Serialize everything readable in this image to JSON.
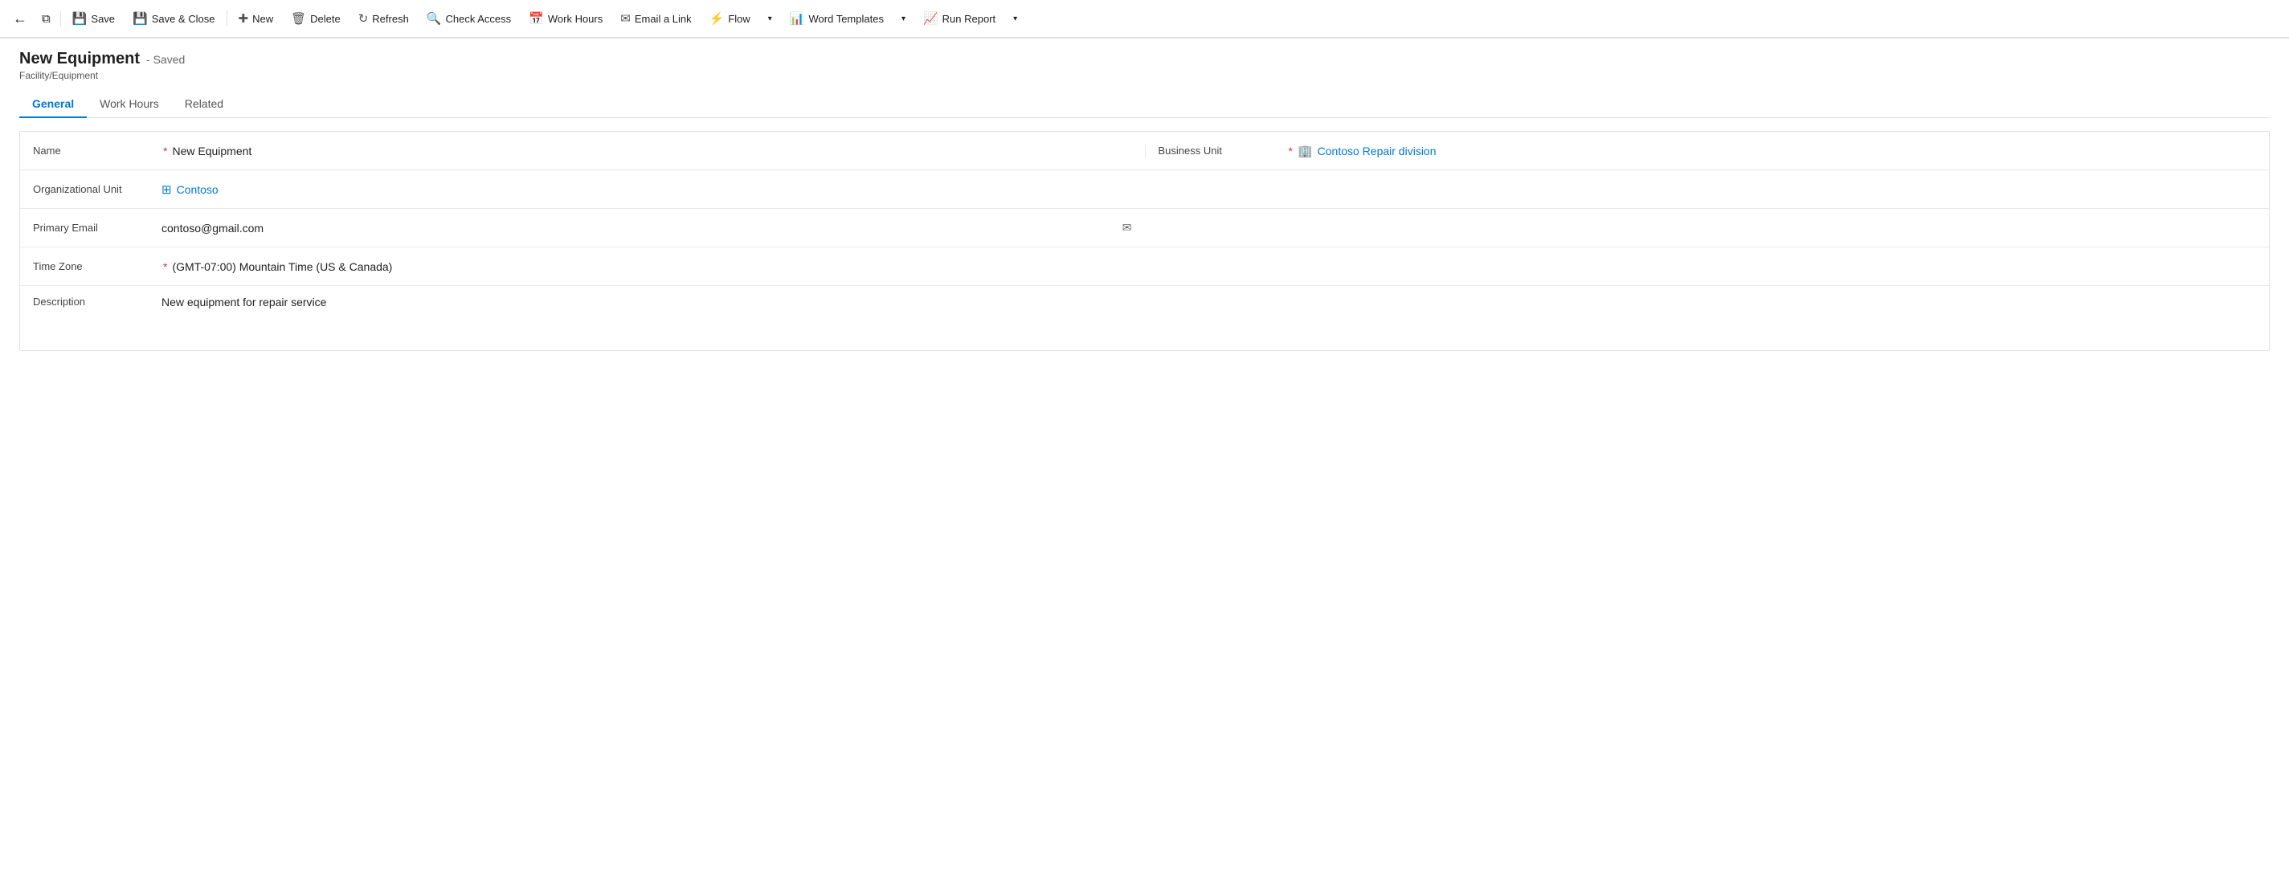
{
  "toolbar": {
    "back_label": "←",
    "window_label": "⧉",
    "save_label": "Save",
    "save_close_label": "Save & Close",
    "new_label": "New",
    "delete_label": "Delete",
    "refresh_label": "Refresh",
    "check_access_label": "Check Access",
    "work_hours_label": "Work Hours",
    "email_link_label": "Email a Link",
    "flow_label": "Flow",
    "word_templates_label": "Word Templates",
    "run_report_label": "Run Report"
  },
  "header": {
    "title": "New Equipment",
    "saved_status": "- Saved",
    "subtitle": "Facility/Equipment"
  },
  "tabs": [
    {
      "label": "General",
      "active": true
    },
    {
      "label": "Work Hours",
      "active": false
    },
    {
      "label": "Related",
      "active": false
    }
  ],
  "form": {
    "name_label": "Name",
    "name_value": "New Equipment",
    "business_unit_label": "Business Unit",
    "business_unit_value": "Contoso Repair division",
    "org_unit_label": "Organizational Unit",
    "org_unit_value": "Contoso",
    "primary_email_label": "Primary Email",
    "primary_email_value": "contoso@gmail.com",
    "timezone_label": "Time Zone",
    "timezone_value": "(GMT-07:00) Mountain Time (US & Canada)",
    "description_label": "Description",
    "description_value": "New equipment for repair service"
  }
}
